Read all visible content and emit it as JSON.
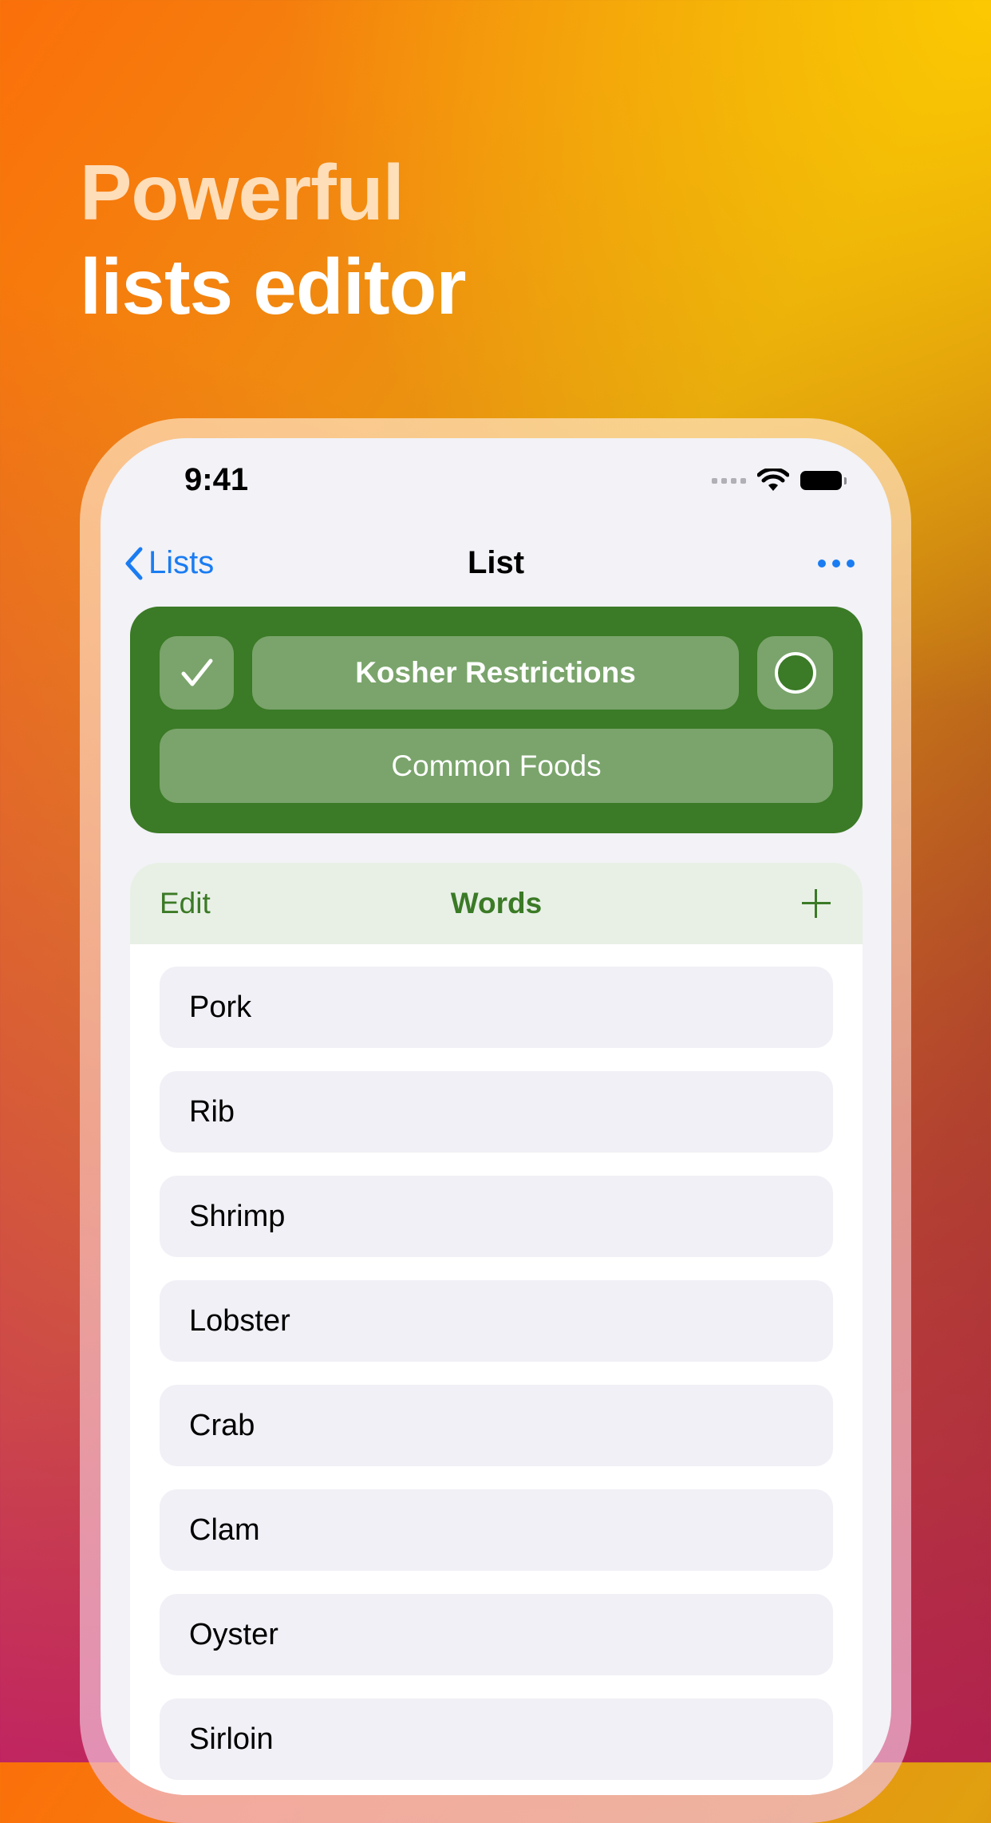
{
  "headline": {
    "line1": "Powerful",
    "line2": "lists editor"
  },
  "status_bar": {
    "time": "9:41"
  },
  "nav": {
    "back_label": "Lists",
    "title": "List"
  },
  "list_card": {
    "title": "Kosher Restrictions",
    "subtitle": "Common Foods",
    "accent_color": "#3b7a26"
  },
  "words_section": {
    "edit_label": "Edit",
    "title": "Words",
    "items": [
      "Pork",
      "Rib",
      "Shrimp",
      "Lobster",
      "Crab",
      "Clam",
      "Oyster",
      "Sirloin"
    ]
  }
}
